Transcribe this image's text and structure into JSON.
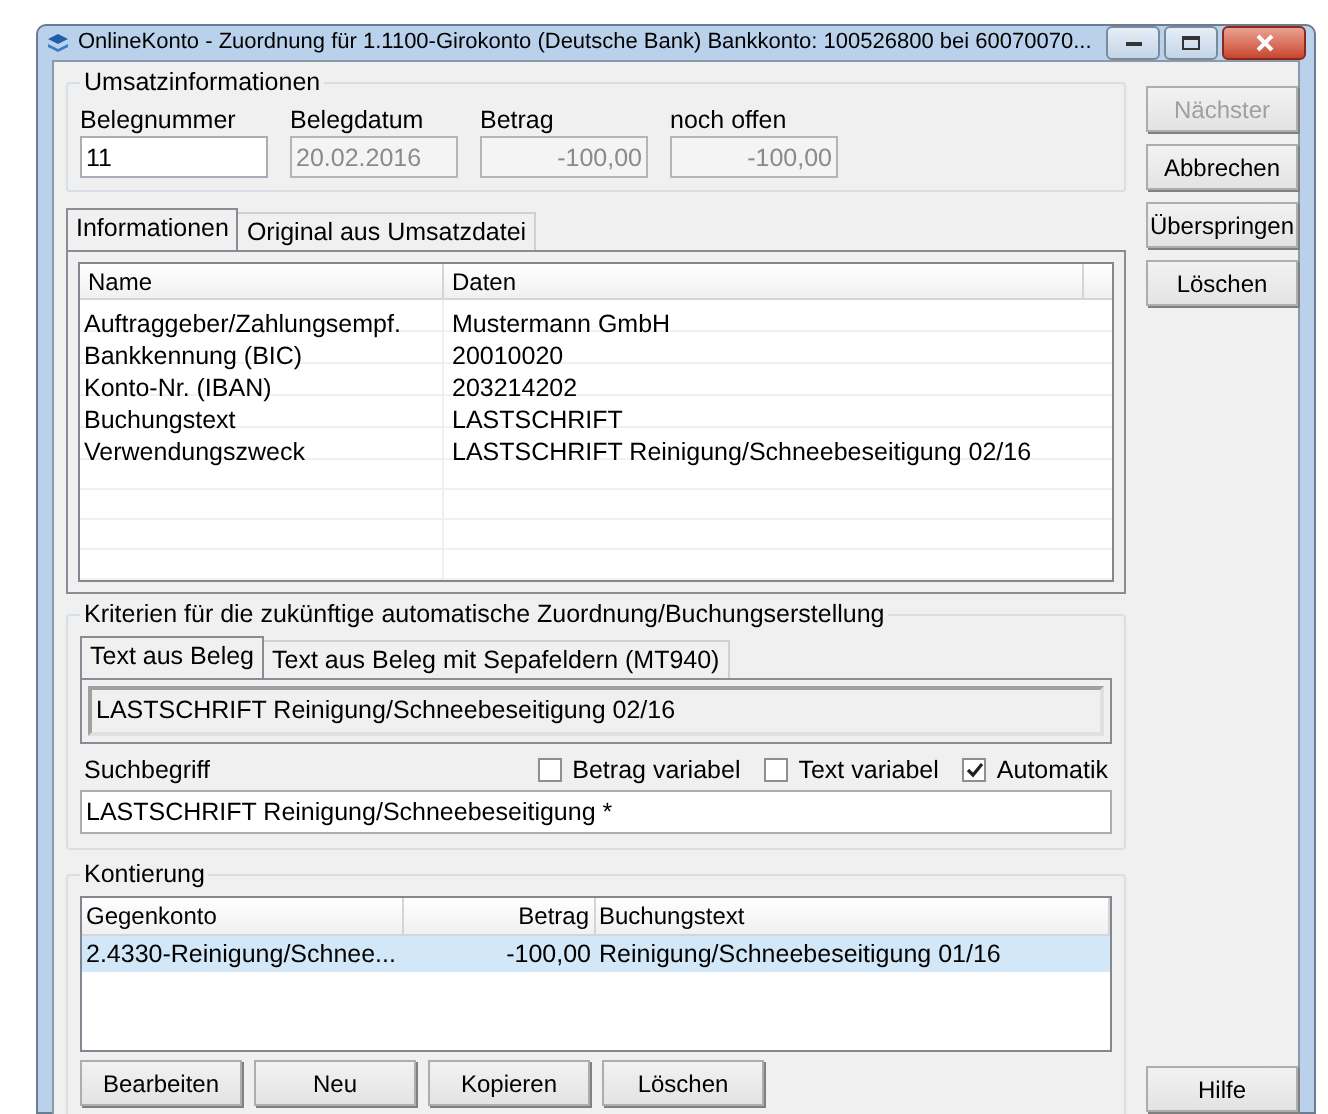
{
  "window": {
    "title": "OnlineKonto - Zuordnung für 1.1100-Girokonto (Deutsche Bank) Bankkonto: 100526800 bei 60070070..."
  },
  "umsatz": {
    "title": "Umsatzinformationen",
    "fields": [
      {
        "label": "Belegnummer",
        "value": "11",
        "disabled": false,
        "kind": "text"
      },
      {
        "label": "Belegdatum",
        "value": "20.02.2016",
        "disabled": true,
        "kind": "text"
      },
      {
        "label": "Betrag",
        "value": "-100,00",
        "disabled": true,
        "kind": "amount"
      },
      {
        "label": "noch offen",
        "value": "-100,00",
        "disabled": true,
        "kind": "amount"
      }
    ]
  },
  "tabs": [
    {
      "label": "Informationen",
      "selected": true
    },
    {
      "label": "Original aus Umsatzdatei",
      "selected": false
    }
  ],
  "info_table": {
    "columns": [
      "Name",
      "Daten"
    ],
    "rows": [
      [
        "Auftraggeber/Zahlungsempf.",
        "Mustermann GmbH"
      ],
      [
        "Bankkennung (BIC)",
        "20010020"
      ],
      [
        "Konto-Nr. (IBAN)",
        "203214202"
      ],
      [
        "Buchungstext",
        "LASTSCHRIFT"
      ],
      [
        "Verwendungszweck",
        "LASTSCHRIFT Reinigung/Schneebeseitigung 02/16"
      ]
    ]
  },
  "kriterien": {
    "title": "Kriterien für die zukünftige automatische Zuordnung/Buchungserstellung",
    "tabs": [
      {
        "label": "Text aus Beleg",
        "selected": true
      },
      {
        "label": "Text aus Beleg mit Sepafeldern (MT940)",
        "selected": false
      }
    ],
    "text": "LASTSCHRIFT Reinigung/Schneebeseitigung 02/16",
    "search_label": "Suchbegriff",
    "checkboxes": [
      {
        "label": "Betrag variabel",
        "checked": false
      },
      {
        "label": "Text variabel",
        "checked": false
      },
      {
        "label": "Automatik",
        "checked": true
      }
    ],
    "search_value": "LASTSCHRIFT Reinigung/Schneebeseitigung *"
  },
  "kontierung": {
    "title": "Kontierung",
    "columns": [
      "Gegenkonto",
      "Betrag",
      "Buchungstext"
    ],
    "rows": [
      {
        "cells": [
          "2.4330-Reinigung/Schnee...",
          "-100,00",
          "Reinigung/Schneebeseitigung 01/16"
        ],
        "selected": true
      }
    ],
    "buttons": [
      "Bearbeiten",
      "Neu",
      "Kopieren",
      "Löschen"
    ]
  },
  "side_buttons": [
    {
      "label": "Nächster",
      "disabled": true
    },
    {
      "label": "Abbrechen",
      "disabled": false
    },
    {
      "label": "Überspringen",
      "disabled": false
    },
    {
      "label": "Löschen",
      "disabled": false
    }
  ],
  "help_button": "Hilfe"
}
